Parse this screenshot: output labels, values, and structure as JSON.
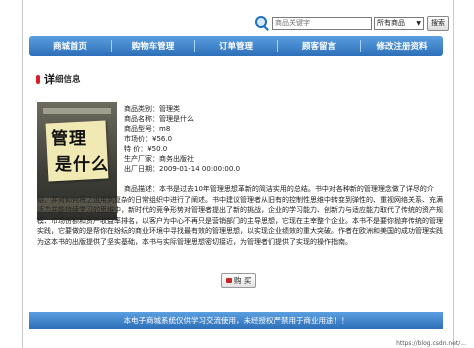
{
  "search": {
    "placeholder": "商品关键字",
    "category": "所有商品",
    "button": "搜索"
  },
  "nav": {
    "items": [
      "商城首页",
      "购物车管理",
      "订单管理",
      "顾客留言",
      "修改注册资料"
    ]
  },
  "section": {
    "title_big": "详",
    "title_small": "细信息"
  },
  "cover": {
    "line1": "管理",
    "line2": "是什么"
  },
  "product": {
    "category": "商品类别：管理类",
    "name": "商品名称：管理是什么",
    "model": "商品型号：m8",
    "market_price": "市场价：¥56.0",
    "special_price": "特  价：¥50.0",
    "maker": "生产厂家：商务出版社",
    "date": "出厂日期：2009-01-14 00:00:00.0",
    "description": "商品描述：本书是过去10年管理思想革新的简洁实用的总结。书中对各种新的管理理念做了详尽的介绍，并对如何将之运用到复杂的日常组织中进行了阐述。书中建议管理者从旧有的控制性思维中转变到弹性的、重视网络关系、充满活力并能持续学习的思维中，新时代的竞争形势对管理者提出了新的挑战，企业的学习能力、创新力与适应能力取代了传统的资产规模、市场份额和资产收益率排名，以客户为中心不再只是营销部门的主导思想，它现在主宰整个企业。本书不是要你抛弃传统的管理实践，它要做的是帮你在纷纭的商业环境中寻找最有效的管理思想，以实现企业绩效的重大突破。作者在欧洲和美国的成功管理实践为这本书的出版提供了坚实基础，本书与实际管理思想密切接近，为管理者们提供了实现的操作指南。"
  },
  "buy_button": "购 买",
  "footer": "本电子商城系统仅供学习交流使用，未经授权严禁用于商业用途！！",
  "watermark": "https://blog.csdn.net/..."
}
